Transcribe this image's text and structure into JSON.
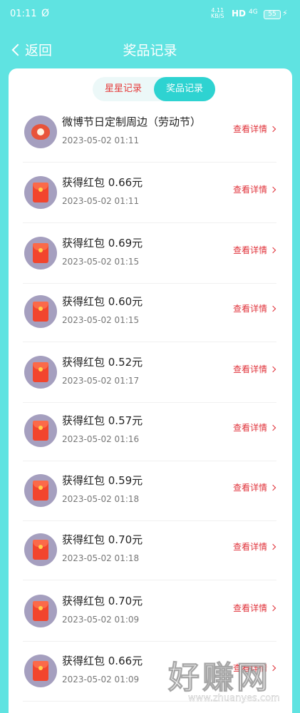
{
  "status_bar": {
    "time": "01:11",
    "sync_icon": "no-sync-icon",
    "speed_value": "4.11",
    "speed_unit": "KB/S",
    "network": "HD",
    "signal": "4G",
    "battery": "55"
  },
  "nav": {
    "back_label": "返回",
    "title": "奖品记录"
  },
  "tabs": [
    {
      "label": "星星记录",
      "active": false
    },
    {
      "label": "奖品记录",
      "active": true
    }
  ],
  "detail_label": "查看详情",
  "records": [
    {
      "icon": "gift-pouch-icon",
      "title": "微博节日定制周边（劳动节）",
      "date": "2023-05-02 01:11"
    },
    {
      "icon": "red-envelope-icon",
      "title": "获得红包 0.66元",
      "date": "2023-05-02 01:11"
    },
    {
      "icon": "red-envelope-icon",
      "title": "获得红包 0.69元",
      "date": "2023-05-02 01:15"
    },
    {
      "icon": "red-envelope-icon",
      "title": "获得红包 0.60元",
      "date": "2023-05-02 01:15"
    },
    {
      "icon": "red-envelope-icon",
      "title": "获得红包 0.52元",
      "date": "2023-05-02 01:17"
    },
    {
      "icon": "red-envelope-icon",
      "title": "获得红包 0.57元",
      "date": "2023-05-02 01:16"
    },
    {
      "icon": "red-envelope-icon",
      "title": "获得红包 0.59元",
      "date": "2023-05-02 01:18"
    },
    {
      "icon": "red-envelope-icon",
      "title": "获得红包 0.70元",
      "date": "2023-05-02 01:18"
    },
    {
      "icon": "red-envelope-icon",
      "title": "获得红包 0.70元",
      "date": "2023-05-02 01:09"
    },
    {
      "icon": "red-envelope-icon",
      "title": "获得红包 0.66元",
      "date": "2023-05-02 01:09"
    }
  ],
  "watermark": {
    "main": "好赚网",
    "url": "www.zhuanyes.com"
  },
  "colors": {
    "background": "#5fe3e1",
    "active_tab": "#2ed3d1",
    "accent_red": "#e0323a"
  }
}
